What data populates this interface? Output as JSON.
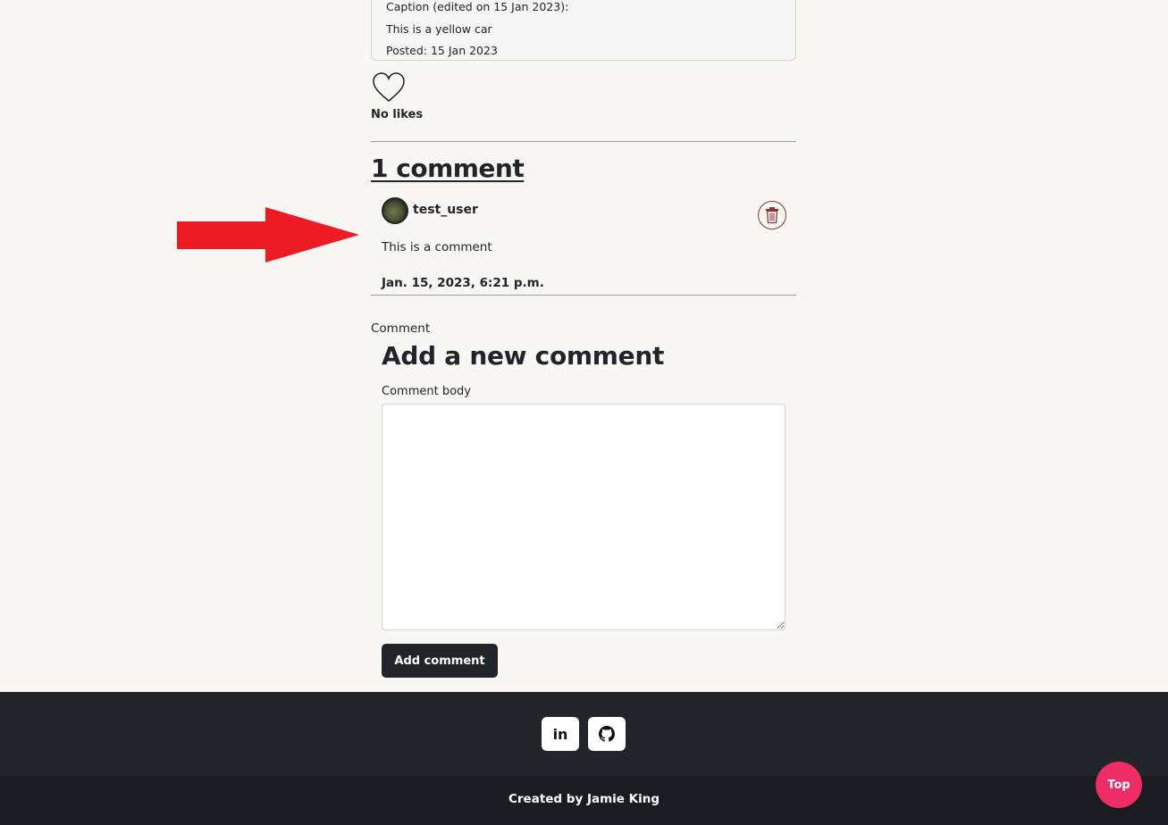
{
  "post": {
    "caption_edited": "Caption (edited on 15 Jan 2023):",
    "caption": "This is a yellow car",
    "posted": "Posted: 15 Jan 2023"
  },
  "likes": {
    "text": "No likes"
  },
  "comments": {
    "heading": "1 comment",
    "items": [
      {
        "username": "test_user",
        "body": "This is a comment",
        "date": "Jan. 15, 2023, 6:21 p.m."
      }
    ]
  },
  "form": {
    "section_label": "Comment",
    "title": "Add a new comment",
    "field_label": "Comment body",
    "textarea_value": "",
    "submit_label": "Add comment"
  },
  "footer": {
    "linkedin_icon": "linkedin-icon",
    "github_icon": "github-icon",
    "linkedin_glyph": "in",
    "credit": "Created by Jamie King"
  },
  "top_button": {
    "label": "Top"
  },
  "colors": {
    "page_bg": "#f8f7f3",
    "footer_bg": "#212529",
    "accent_pink": "#ee2d66",
    "annotation_arrow": "#ed1c24"
  }
}
